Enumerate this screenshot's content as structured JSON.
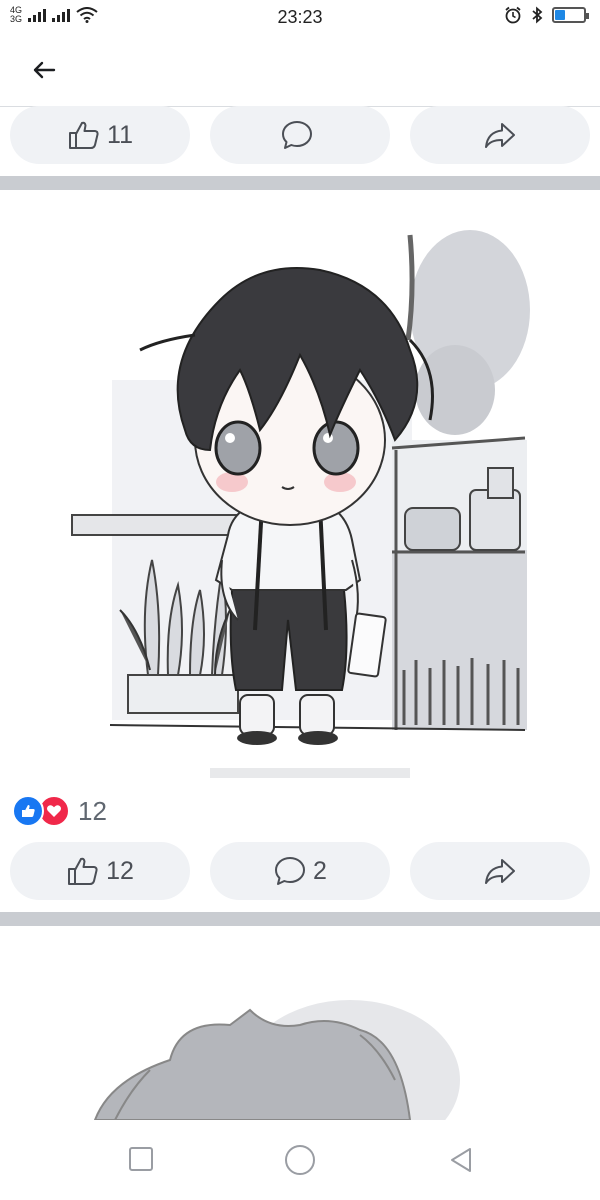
{
  "status_bar": {
    "network_top": "4G",
    "network_bottom": "3G",
    "time": "23:23",
    "battery_level": 0.35,
    "icons": [
      "signal-icon",
      "wifi-icon",
      "alarm-icon",
      "bluetooth-icon",
      "battery-icon"
    ]
  },
  "header": {
    "back_icon": "arrow-left-icon"
  },
  "post1_actions": {
    "like_count": "11",
    "comment_count": "",
    "icons": [
      "thumbs-up-icon",
      "comment-icon",
      "share-icon"
    ]
  },
  "post2": {
    "reaction_count": "12",
    "like_count": "12",
    "comment_count": "2",
    "reaction_icons": [
      "like-reaction-icon",
      "love-reaction-icon"
    ],
    "image_description": "chibi illustration"
  },
  "colors": {
    "like_blue": "#1877f2",
    "love_red": "#f0284a",
    "pill_bg": "#f0f2f5",
    "divider": "#c9ccd1"
  },
  "nav_bar": {
    "icons": [
      "recent-apps-icon",
      "home-icon",
      "back-icon"
    ]
  }
}
